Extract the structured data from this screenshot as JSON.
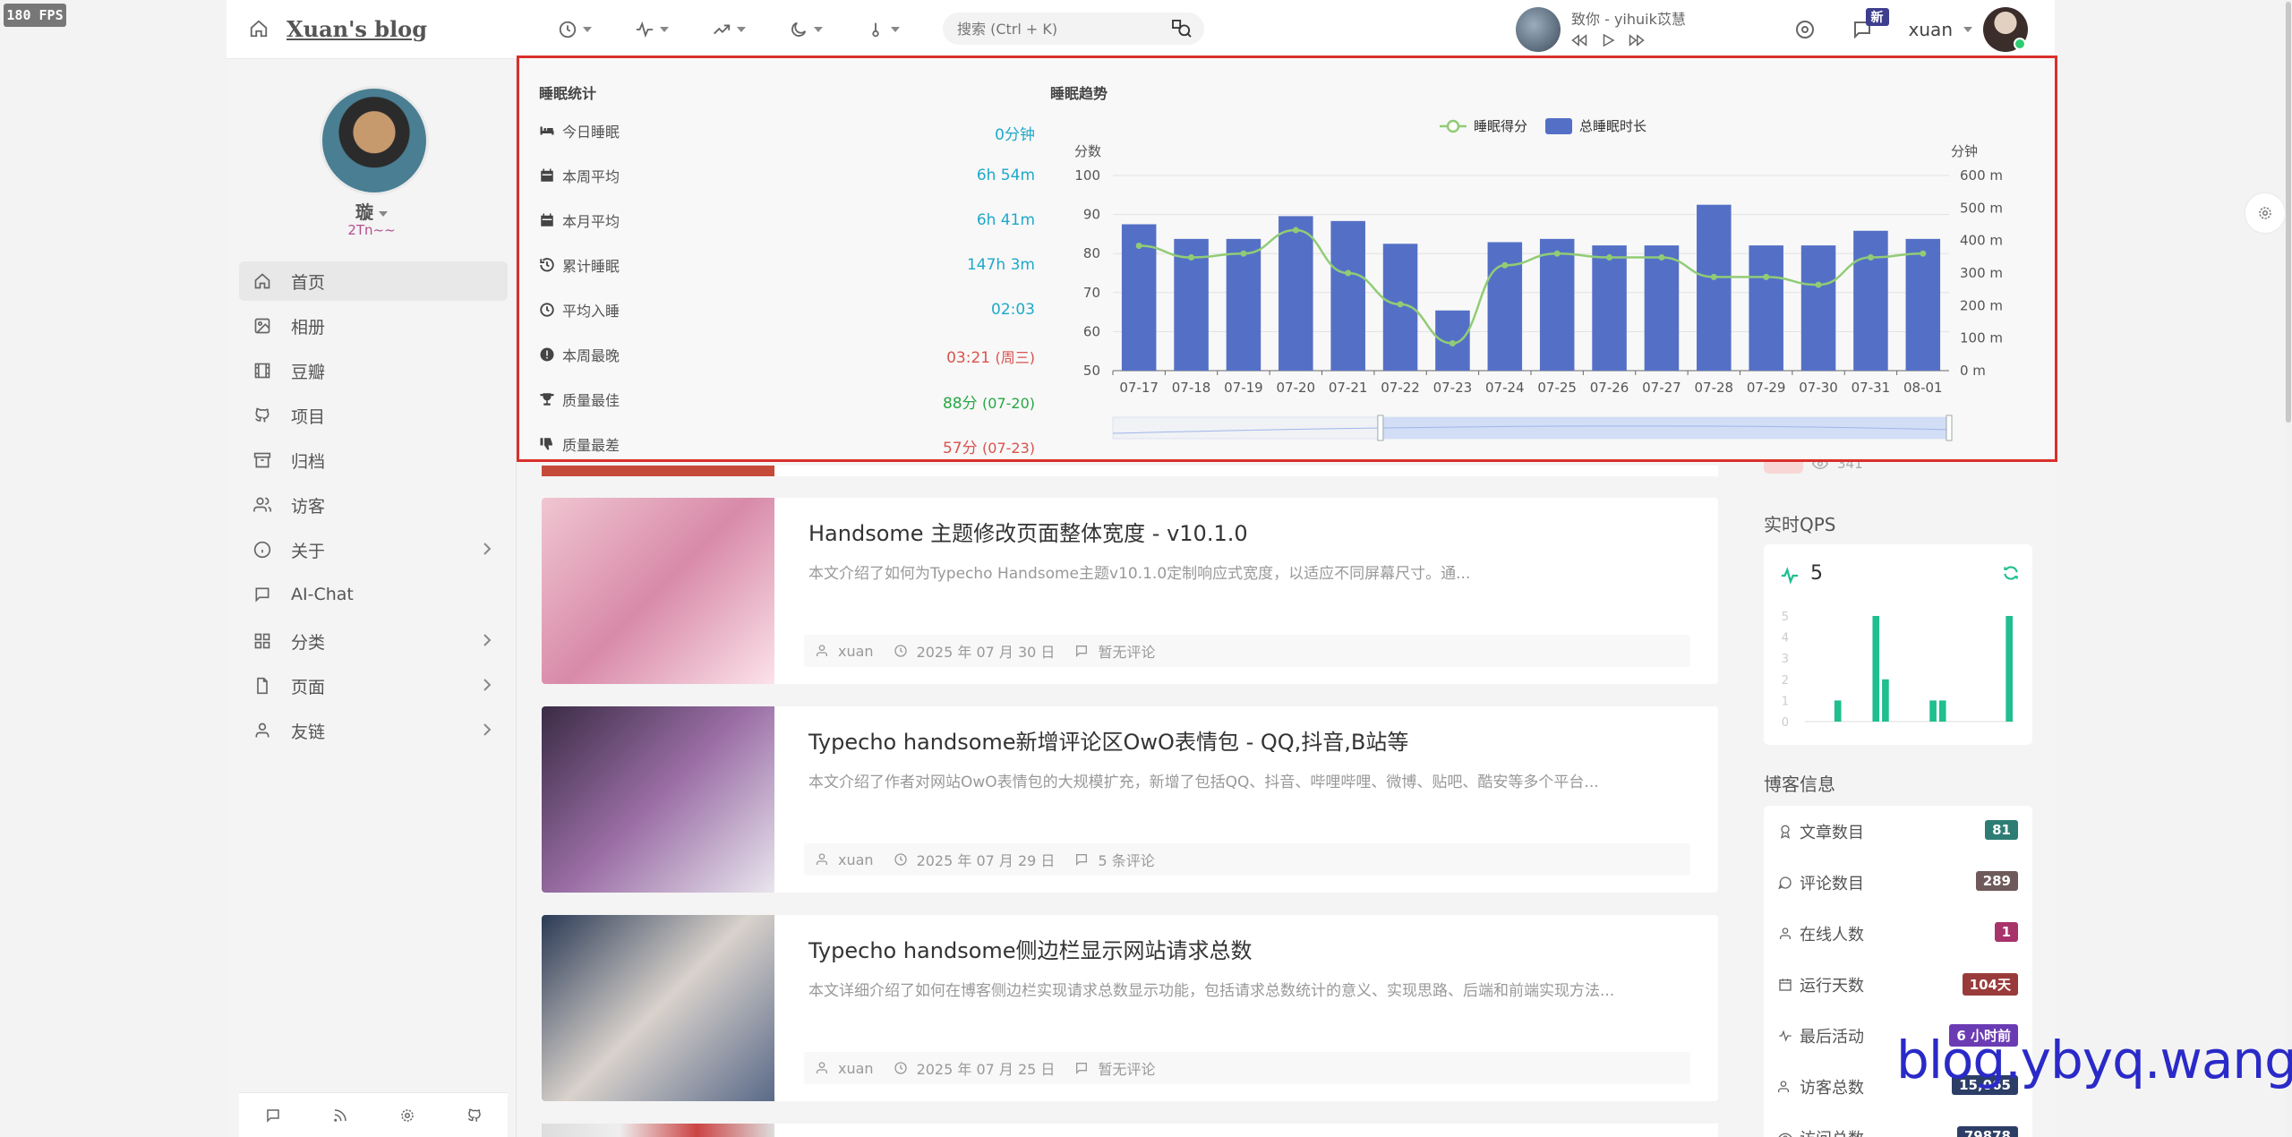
{
  "fps": "180 FPS",
  "header": {
    "brand_title": "Xuan's blog",
    "search_placeholder": "搜索 (Ctrl + K)",
    "music_title": "致你 - yihuik苡慧",
    "notify_badge": "新",
    "user_name": "xuan"
  },
  "profile": {
    "name": "璇",
    "subtitle": "2Tn~~"
  },
  "menu": [
    {
      "label": "首页",
      "icon": "home-icon"
    },
    {
      "label": "相册",
      "icon": "image-icon"
    },
    {
      "label": "豆瓣",
      "icon": "film-icon"
    },
    {
      "label": "项目",
      "icon": "github-icon"
    },
    {
      "label": "归档",
      "icon": "archive-icon"
    },
    {
      "label": "访客",
      "icon": "users-icon"
    },
    {
      "label": "关于",
      "icon": "info-icon"
    },
    {
      "label": "AI-Chat",
      "icon": "chat-icon"
    },
    {
      "label": "分类",
      "icon": "grid-icon"
    },
    {
      "label": "页面",
      "icon": "file-icon"
    },
    {
      "label": "友链",
      "icon": "user-icon"
    }
  ],
  "posts": [
    {
      "title": "Handsome 主题修改页面整体宽度 - v10.1.0",
      "desc": "本文介绍了如何为Typecho Handsome主题v10.1.0定制响应式宽度，以适应不同屏幕尺寸。通...",
      "author": "xuan",
      "date": "2025 年 07 月 30 日",
      "comments": "暂无评论",
      "thumb_colors": [
        "#f0c6d2",
        "#d88aa8",
        "#fbe2ea"
      ]
    },
    {
      "title": "Typecho handsome新增评论区OwO表情包 - QQ,抖音,B站等",
      "desc": "本文介绍了作者对网站OwO表情包的大规模扩充，新增了包括QQ、抖音、哔哩哔哩、微博、贴吧、酷安等多个平台...",
      "author": "xuan",
      "date": "2025 年 07 月 29 日",
      "comments": "5 条评论",
      "thumb_colors": [
        "#3a2b45",
        "#9b6fa6",
        "#e9e5ee"
      ]
    },
    {
      "title": "Typecho handsome侧边栏显示网站请求总数",
      "desc": "本文详细介绍了如何在博客侧边栏实现请求总数显示功能，包括请求总数统计的意义、实现思路、后端和前端实现方法...",
      "author": "xuan",
      "date": "2025 年 07 月 25 日",
      "comments": "暂无评论",
      "thumb_colors": [
        "#2a3a55",
        "#d9d2cc",
        "#5a6a88"
      ]
    }
  ],
  "right": {
    "views": "341",
    "qps_title": "实时QPS",
    "qps_value": "5",
    "qps_chart": {
      "ylim": [
        0,
        5
      ],
      "yticks": [
        "0",
        "1",
        "2",
        "3",
        "4",
        "5"
      ],
      "values": [
        0,
        0,
        0,
        1,
        0,
        0,
        0,
        5,
        2,
        0,
        0,
        0,
        0,
        1,
        1,
        0,
        0,
        0,
        0,
        0,
        0,
        5
      ]
    },
    "blog_info_title": "博客信息",
    "stats": [
      {
        "label": "文章数目",
        "value": "81",
        "color": "#2e7d74",
        "icon": "award-icon"
      },
      {
        "label": "评论数目",
        "value": "289",
        "color": "#6e5a5a",
        "icon": "comment-icon"
      },
      {
        "label": "在线人数",
        "value": "1",
        "color": "#a8336b",
        "icon": "person-icon"
      },
      {
        "label": "运行天数",
        "value": "104天",
        "color": "#9a3b3b",
        "icon": "calendar-icon"
      },
      {
        "label": "最后活动",
        "value": "6 小时前",
        "color": "#6b3bb4",
        "icon": "activity-icon"
      },
      {
        "label": "访客总数",
        "value": "15,065",
        "color": "#2d3e66",
        "icon": "visitors-icon"
      },
      {
        "label": "访问总数",
        "value": "79878",
        "color": "#2d3e66",
        "icon": "eye-icon"
      }
    ]
  },
  "watermark": "blog.ybyq.wang",
  "sleep": {
    "stats_title": "睡眠统计",
    "trend_title": "睡眠趋势",
    "rows": [
      {
        "label": "今日睡眠",
        "value": "0分钟",
        "extra": "",
        "color": "#1fa8c9",
        "icon": "bed-icon"
      },
      {
        "label": "本周平均",
        "value": "6h 54m",
        "extra": "",
        "color": "#1fa8c9",
        "icon": "calendar-icon"
      },
      {
        "label": "本月平均",
        "value": "6h 41m",
        "extra": "",
        "color": "#1fa8c9",
        "icon": "calendar-icon"
      },
      {
        "label": "累计睡眠",
        "value": "147h 3m",
        "extra": "",
        "color": "#1fa8c9",
        "icon": "history-icon"
      },
      {
        "label": "平均入睡",
        "value": "02:03",
        "extra": "",
        "color": "#1fa8c9",
        "icon": "clock-icon"
      },
      {
        "label": "本周最晚",
        "value": "03:21",
        "extra": "(周三)",
        "color": "#d9534f",
        "icon": "alert-icon"
      },
      {
        "label": "质量最佳",
        "value": "88分",
        "extra": "(07-20)",
        "color": "#28a745",
        "icon": "trophy-icon"
      },
      {
        "label": "质量最差",
        "value": "57分",
        "extra": "(07-23)",
        "color": "#d9534f",
        "icon": "thumbs-down-icon"
      }
    ]
  },
  "chart_data": {
    "type": "bar",
    "categories": [
      "07-17",
      "07-18",
      "07-19",
      "07-20",
      "07-21",
      "07-22",
      "07-23",
      "07-24",
      "07-25",
      "07-26",
      "07-27",
      "07-28",
      "07-29",
      "07-30",
      "07-31",
      "08-01"
    ],
    "series": [
      {
        "name": "总睡眠时长",
        "type": "bar",
        "axis": "right",
        "values": [
          450,
          405,
          405,
          475,
          460,
          390,
          185,
          395,
          405,
          385,
          385,
          510,
          385,
          385,
          430,
          405
        ]
      },
      {
        "name": "睡眠得分",
        "type": "line",
        "axis": "left",
        "values": [
          82,
          79,
          80,
          86,
          75,
          67,
          57,
          77,
          80,
          79,
          79,
          74,
          74,
          72,
          79,
          80
        ]
      }
    ],
    "ylabel_left": "分数",
    "ylabel_right": "分钟",
    "ylim_left": [
      50,
      100
    ],
    "yticks_left": [
      "50",
      "60",
      "70",
      "80",
      "90",
      "100"
    ],
    "ylim_right": [
      0,
      600
    ],
    "yticks_right": [
      "0 m",
      "100 m",
      "200 m",
      "300 m",
      "400 m",
      "500 m",
      "600 m"
    ],
    "legend": "top-center",
    "grid": true,
    "colors": {
      "bar": "#5470c6",
      "line": "#91cc75"
    }
  }
}
